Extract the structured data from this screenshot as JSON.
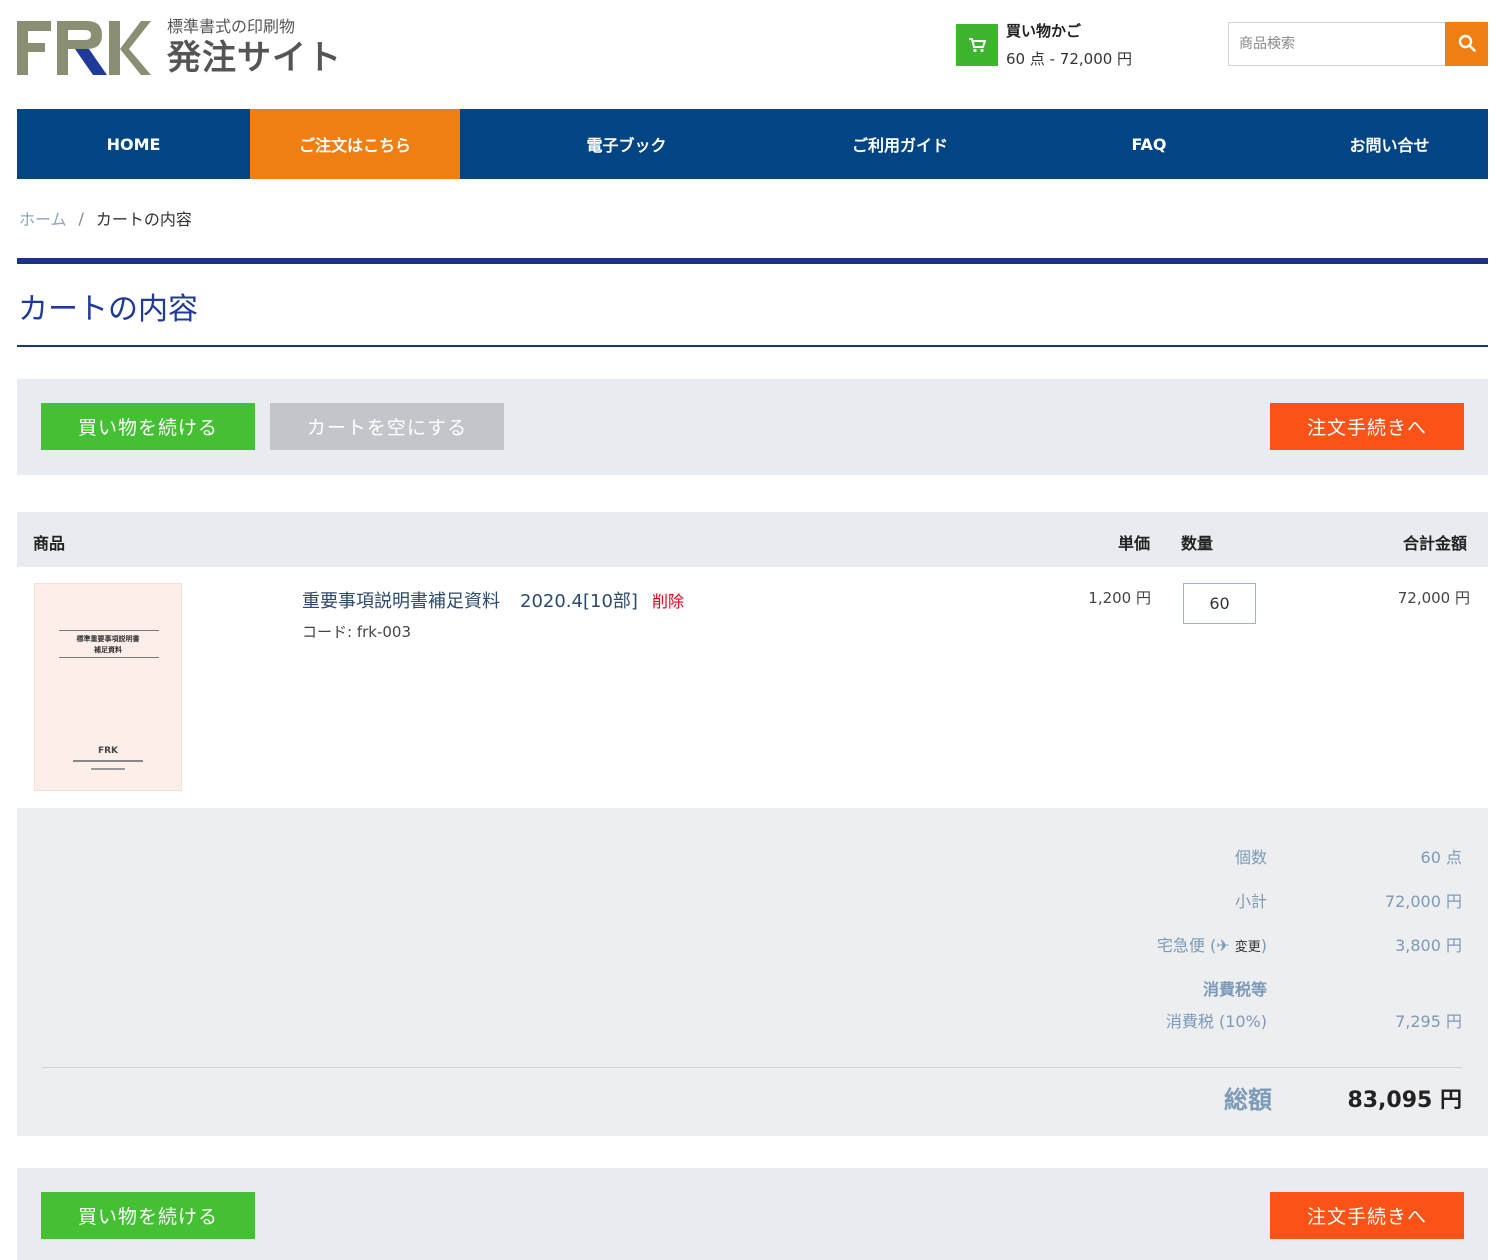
{
  "header": {
    "logo_subtitle": "標準書式の印刷物",
    "logo_title": "発注サイト",
    "cart": {
      "title": "買い物かご",
      "totals": "60 点 - 72,000 円"
    },
    "search": {
      "placeholder": "商品検索"
    }
  },
  "nav": {
    "items": [
      {
        "label": "HOME"
      },
      {
        "label": "ご注文はこちら"
      },
      {
        "label": "電子ブック"
      },
      {
        "label": "ご利用ガイド"
      },
      {
        "label": "FAQ"
      },
      {
        "label": "お問い合せ"
      }
    ]
  },
  "breadcrumb": {
    "home": "ホーム",
    "separator": "/",
    "current": "カートの内容"
  },
  "page_title": "カートの内容",
  "actions": {
    "continue_shopping": "買い物を続ける",
    "empty_cart": "カートを空にする",
    "checkout": "注文手続きへ"
  },
  "table": {
    "headers": {
      "product": "商品",
      "unit_price": "単価",
      "quantity": "数量",
      "total": "合計金額"
    },
    "rows": [
      {
        "name": "重要事項説明書補足資料",
        "variant": "2020.4[10部]",
        "delete": "削除",
        "code": "コード: frk-003",
        "unit_price": "1,200 円",
        "quantity": "60",
        "total": "72,000 円",
        "image": {
          "title_line1": "標準重要事項説明書",
          "title_line2": "補足資料",
          "logo": "FRK"
        }
      }
    ]
  },
  "totals": {
    "count_label": "個数",
    "count_value": "60 点",
    "subtotal_label": "小計",
    "subtotal_value": "72,000 円",
    "shipping_label": "宅急便 (",
    "shipping_change": "変更",
    "shipping_close": ")",
    "shipping_value": "3,800 円",
    "tax_heading": "消費税等",
    "tax_label": "消費税 (10%)",
    "tax_value": "7,295 円",
    "grand_label": "総額",
    "grand_value": "83,095 円"
  },
  "colors": {
    "nav_bg": "#024582",
    "accent_orange": "#f07f13",
    "green": "#45bf33",
    "checkout_red": "#fb5217",
    "title_blue": "#1f3a99"
  }
}
